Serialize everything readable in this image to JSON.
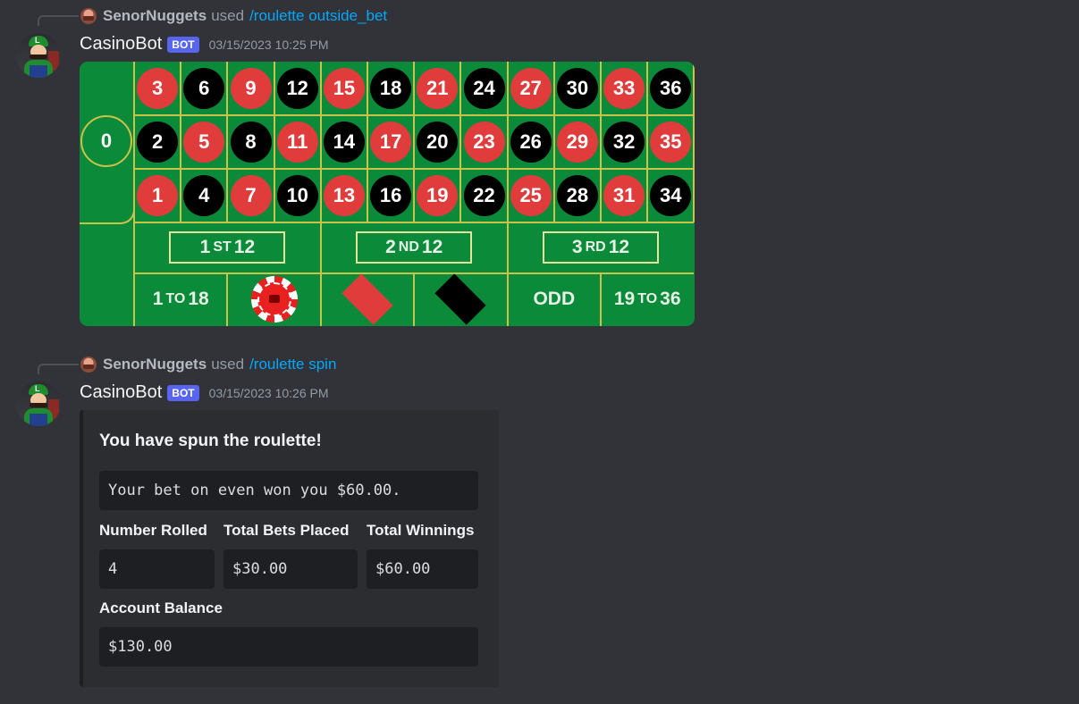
{
  "messages": [
    {
      "reply": {
        "user": "SenorNuggets",
        "used": "used",
        "command": "/roulette outside_bet"
      },
      "bot": {
        "name": "CasinoBot",
        "badge": "BOT",
        "timestamp": "03/15/2023 10:25 PM"
      }
    },
    {
      "reply": {
        "user": "SenorNuggets",
        "used": "used",
        "command": "/roulette spin"
      },
      "bot": {
        "name": "CasinoBot",
        "badge": "BOT",
        "timestamp": "03/15/2023 10:26 PM"
      }
    }
  ],
  "roulette": {
    "zero": "0",
    "rows": [
      [
        {
          "n": "3",
          "c": "red"
        },
        {
          "n": "6",
          "c": "black"
        },
        {
          "n": "9",
          "c": "red"
        },
        {
          "n": "12",
          "c": "black"
        },
        {
          "n": "15",
          "c": "red"
        },
        {
          "n": "18",
          "c": "black"
        },
        {
          "n": "21",
          "c": "red"
        },
        {
          "n": "24",
          "c": "black"
        },
        {
          "n": "27",
          "c": "red"
        },
        {
          "n": "30",
          "c": "black"
        },
        {
          "n": "33",
          "c": "red"
        },
        {
          "n": "36",
          "c": "black"
        }
      ],
      [
        {
          "n": "2",
          "c": "black"
        },
        {
          "n": "5",
          "c": "red"
        },
        {
          "n": "8",
          "c": "black"
        },
        {
          "n": "11",
          "c": "red"
        },
        {
          "n": "14",
          "c": "black"
        },
        {
          "n": "17",
          "c": "red"
        },
        {
          "n": "20",
          "c": "black"
        },
        {
          "n": "23",
          "c": "red"
        },
        {
          "n": "26",
          "c": "black"
        },
        {
          "n": "29",
          "c": "red"
        },
        {
          "n": "32",
          "c": "black"
        },
        {
          "n": "35",
          "c": "red"
        }
      ],
      [
        {
          "n": "1",
          "c": "red"
        },
        {
          "n": "4",
          "c": "black"
        },
        {
          "n": "7",
          "c": "red"
        },
        {
          "n": "10",
          "c": "black"
        },
        {
          "n": "13",
          "c": "red"
        },
        {
          "n": "16",
          "c": "black"
        },
        {
          "n": "19",
          "c": "red"
        },
        {
          "n": "22",
          "c": "black"
        },
        {
          "n": "25",
          "c": "red"
        },
        {
          "n": "28",
          "c": "black"
        },
        {
          "n": "31",
          "c": "red"
        },
        {
          "n": "34",
          "c": "black"
        }
      ]
    ],
    "dozens": [
      {
        "num": "1",
        "suffix": "ST",
        "value": "12"
      },
      {
        "num": "2",
        "suffix": "ND",
        "value": "12"
      },
      {
        "num": "3",
        "suffix": "RD",
        "value": "12"
      }
    ],
    "low": {
      "from": "1",
      "to": "TO",
      "end": "18"
    },
    "odd": "ODD",
    "high": {
      "from": "19",
      "to": "TO",
      "end": "36"
    },
    "chip_position": "even",
    "colors": {
      "felt": "#0b8a3a",
      "line": "#c9c34a",
      "red": "#e03c3c",
      "black": "#000000"
    }
  },
  "embed": {
    "title": "You have spun the roulette!",
    "result": "Your bet on even won you $60.00.",
    "fields": [
      {
        "label": "Number Rolled",
        "value": "4"
      },
      {
        "label": "Total Bets Placed",
        "value": "$30.00"
      },
      {
        "label": "Total Winnings",
        "value": "$60.00"
      }
    ],
    "balance": {
      "label": "Account Balance",
      "value": "$130.00"
    }
  }
}
